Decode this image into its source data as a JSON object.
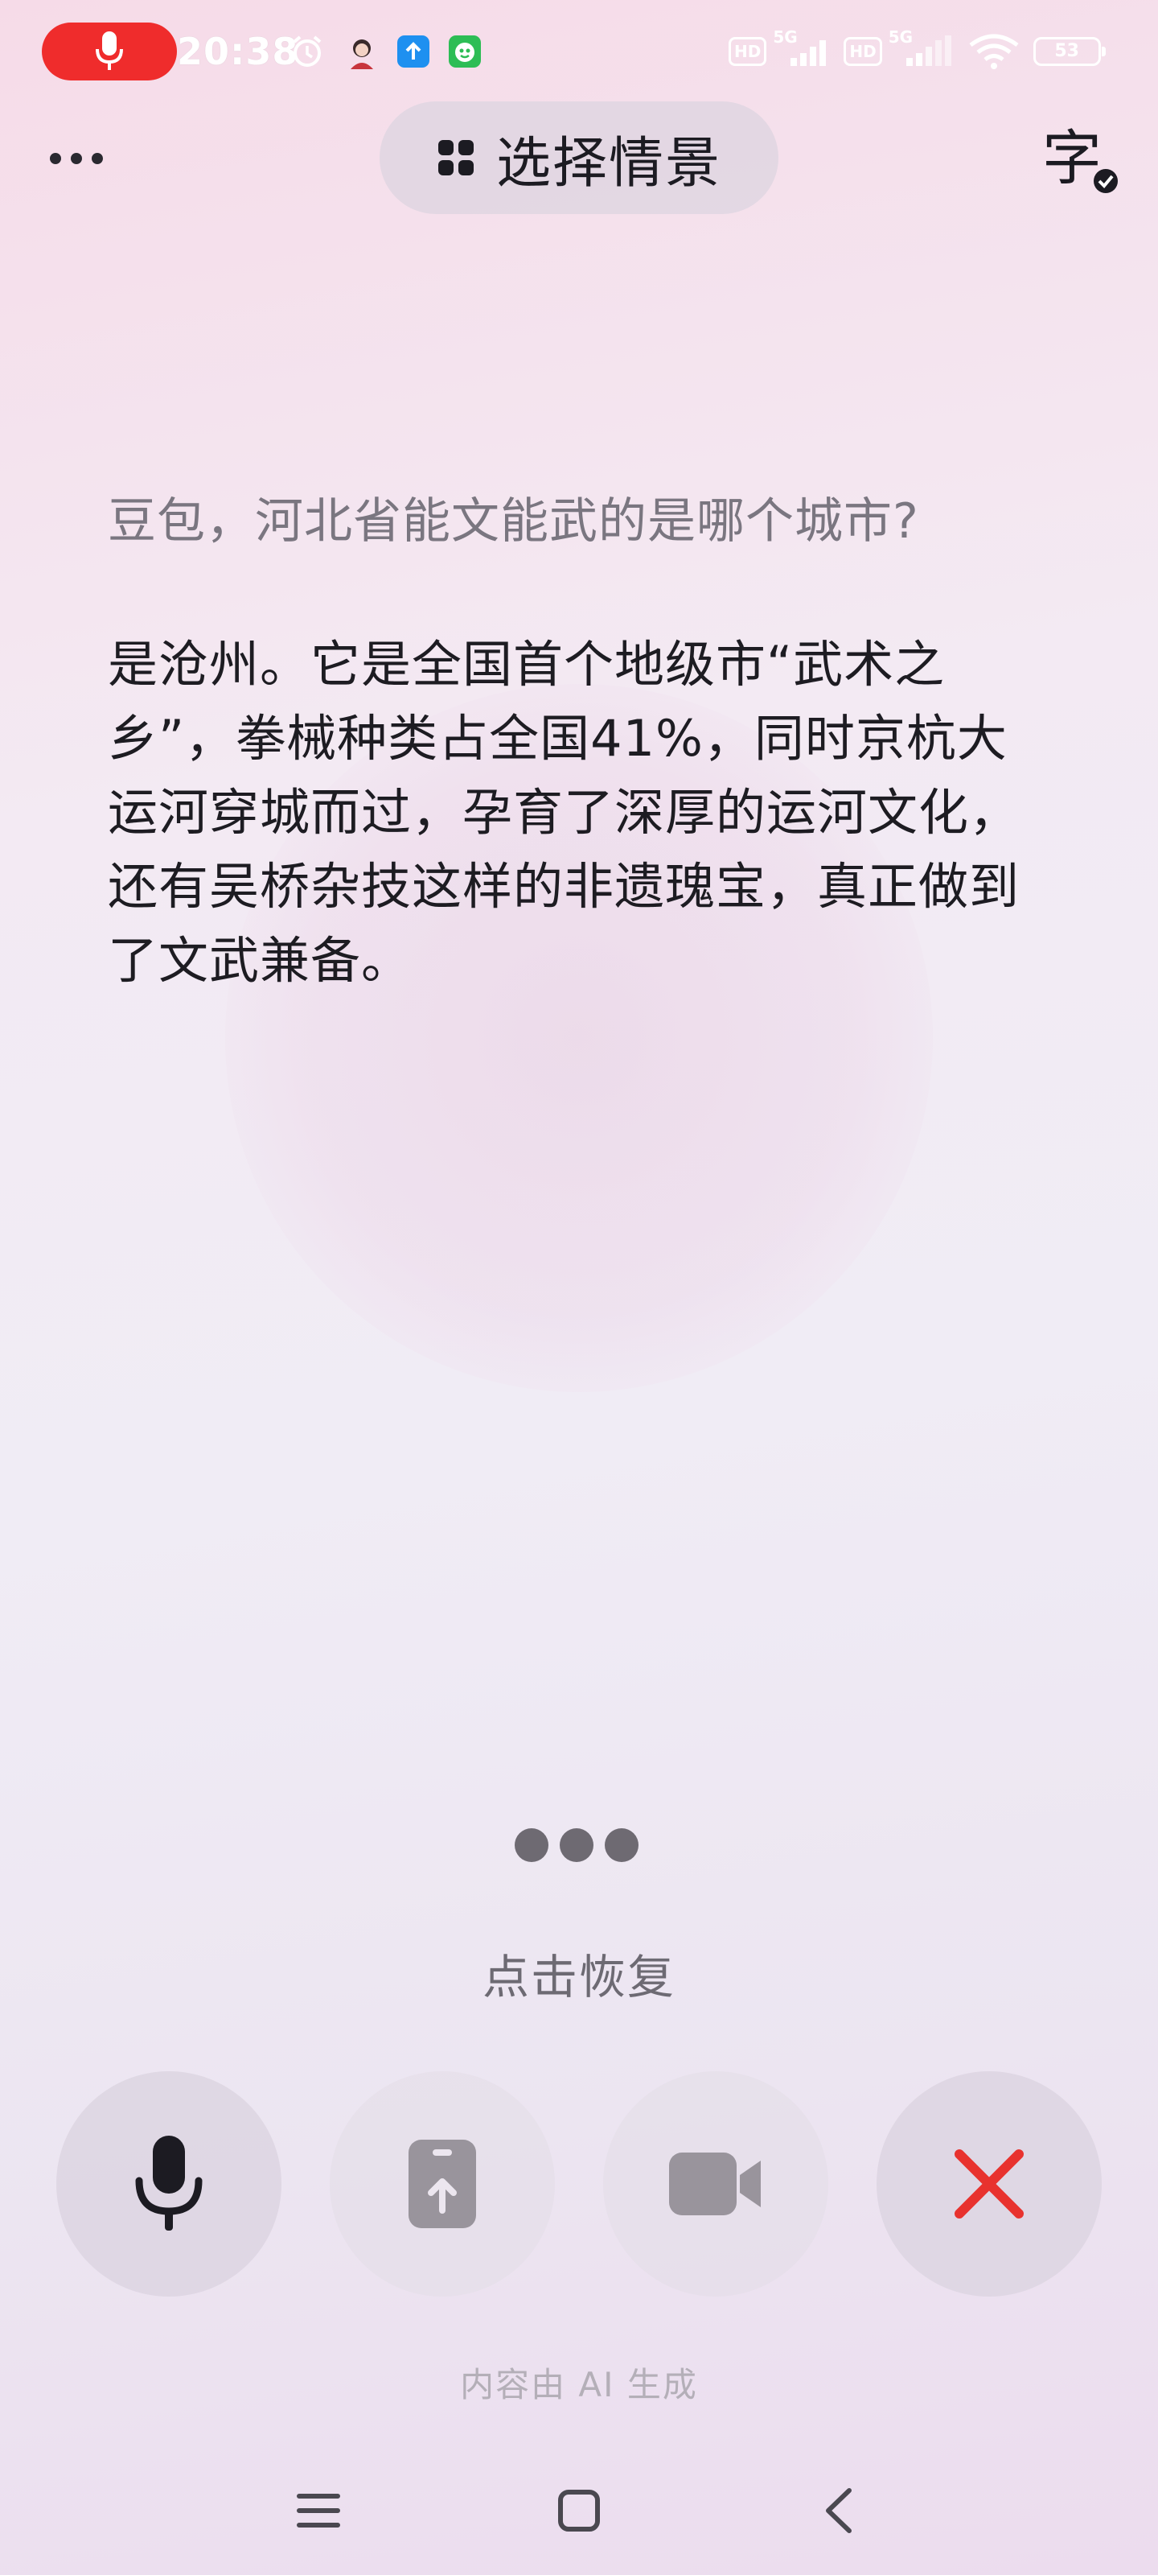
{
  "status_bar": {
    "time": "20:38",
    "icons_left": [
      "microphone-recording-icon",
      "alarm-icon",
      "avatar-app-icon",
      "upload-app-icon",
      "green-app-icon"
    ],
    "icons_right": [
      "hd-icon",
      "signal-5g-icon",
      "hd-icon",
      "signal-5g-icon",
      "wifi-icon",
      "battery-icon"
    ],
    "network_1": "5G",
    "network_2": "5G",
    "hd_1": "HD",
    "hd_2": "HD",
    "battery": "53",
    "record_color": "#ef2c2c"
  },
  "top_bar": {
    "scene_label": "选择情景",
    "caption_char": "字"
  },
  "conversation": {
    "question": "豆包，河北省能文能武的是哪个城市?",
    "answer": "是沧州。它是全国首个地级市“武术之乡”，拳械种类占全国41%，同时京杭大运河穿城而过，孕育了深厚的运河文化，还有吴桥杂技这样的非遗瑰宝，真正做到了文武兼备。"
  },
  "status": {
    "resume_label": "点击恢复"
  },
  "controls": {
    "close_color": "#e8322e"
  },
  "footer": {
    "ai_note": "内容由 AI 生成"
  }
}
